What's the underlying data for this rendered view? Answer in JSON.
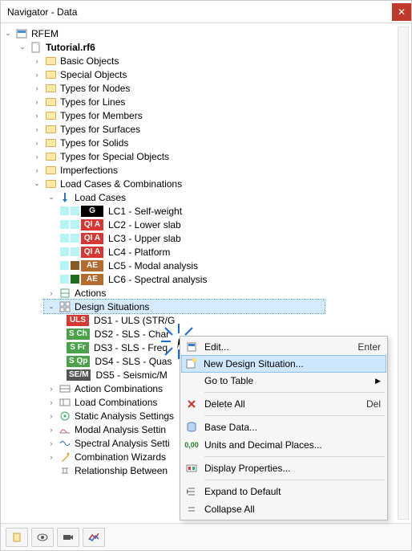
{
  "window": {
    "title": "Navigator - Data"
  },
  "tree": {
    "root": "RFEM",
    "file": "Tutorial.rf6",
    "folders": {
      "basic_objects": "Basic Objects",
      "special_objects": "Special Objects",
      "types_nodes": "Types for Nodes",
      "types_lines": "Types for Lines",
      "types_members": "Types for Members",
      "types_surfaces": "Types for Surfaces",
      "types_solids": "Types for Solids",
      "types_special": "Types for Special Objects",
      "imperfections": "Imperfections",
      "load_comb": "Load Cases & Combinations"
    },
    "load_cases": {
      "header": "Load Cases",
      "items": [
        {
          "sq1": "#b7f4f4",
          "sq2": "#b7f4f4",
          "tag": "G",
          "tag_cls": "tag-g",
          "label": "LC1 - Self-weight"
        },
        {
          "sq1": "#b7f4f4",
          "sq2": "#b7f4f4",
          "tag": "QI A",
          "tag_cls": "tag-qia",
          "label": "LC2 - Lower slab"
        },
        {
          "sq1": "#b7f4f4",
          "sq2": "#b7f4f4",
          "tag": "QI A",
          "tag_cls": "tag-qia",
          "label": "LC3 - Upper slab"
        },
        {
          "sq1": "#b7f4f4",
          "sq2": "#b7f4f4",
          "tag": "QI A",
          "tag_cls": "tag-qia",
          "label": "LC4 - Platform"
        },
        {
          "sq1": "#b7f4f4",
          "sq2": "#8a5a24",
          "tag": "AE",
          "tag_cls": "tag-ae",
          "label": "LC5 - Modal analysis"
        },
        {
          "sq1": "#b7f4f4",
          "sq2": "#1f6b1f",
          "tag": "AE",
          "tag_cls": "tag-ae",
          "label": "LC6 - Spectral analysis"
        }
      ]
    },
    "actions": "Actions",
    "design_situations": {
      "header": "Design Situations",
      "items": [
        {
          "tag": "ULS",
          "tag_cls": "tag-uls",
          "label": "DS1 - ULS (STR/G"
        },
        {
          "tag": "S Ch",
          "tag_cls": "tag-sch",
          "label": "DS2 - SLS - Char"
        },
        {
          "tag": "S Fr",
          "tag_cls": "tag-sfr",
          "label": "DS3 - SLS - Freq"
        },
        {
          "tag": "S Qp",
          "tag_cls": "tag-sqp",
          "label": "DS4 - SLS - Quas"
        },
        {
          "tag": "SE/M",
          "tag_cls": "tag-sem",
          "label": "DS5 - Seismic/M"
        }
      ]
    },
    "more": {
      "action_combinations": "Action Combinations",
      "load_combinations": "Load Combinations",
      "static_analysis": "Static Analysis Settings",
      "modal_analysis": "Modal Analysis Settin",
      "spectral_analysis": "Spectral Analysis Setti",
      "combination_wizards": "Combination Wizards",
      "relationship": "Relationship Between"
    }
  },
  "context_menu": {
    "edit": {
      "label": "Edit...",
      "accel": "Enter"
    },
    "new": {
      "label": "New Design Situation..."
    },
    "goto": {
      "label": "Go to Table"
    },
    "delete_all": {
      "label": "Delete All",
      "accel": "Del"
    },
    "base_data": {
      "label": "Base Data..."
    },
    "units": {
      "label": "Units and Decimal Places..."
    },
    "display_props": {
      "label": "Display Properties..."
    },
    "expand": {
      "label": "Expand to Default"
    },
    "collapse": {
      "label": "Collapse All"
    }
  }
}
